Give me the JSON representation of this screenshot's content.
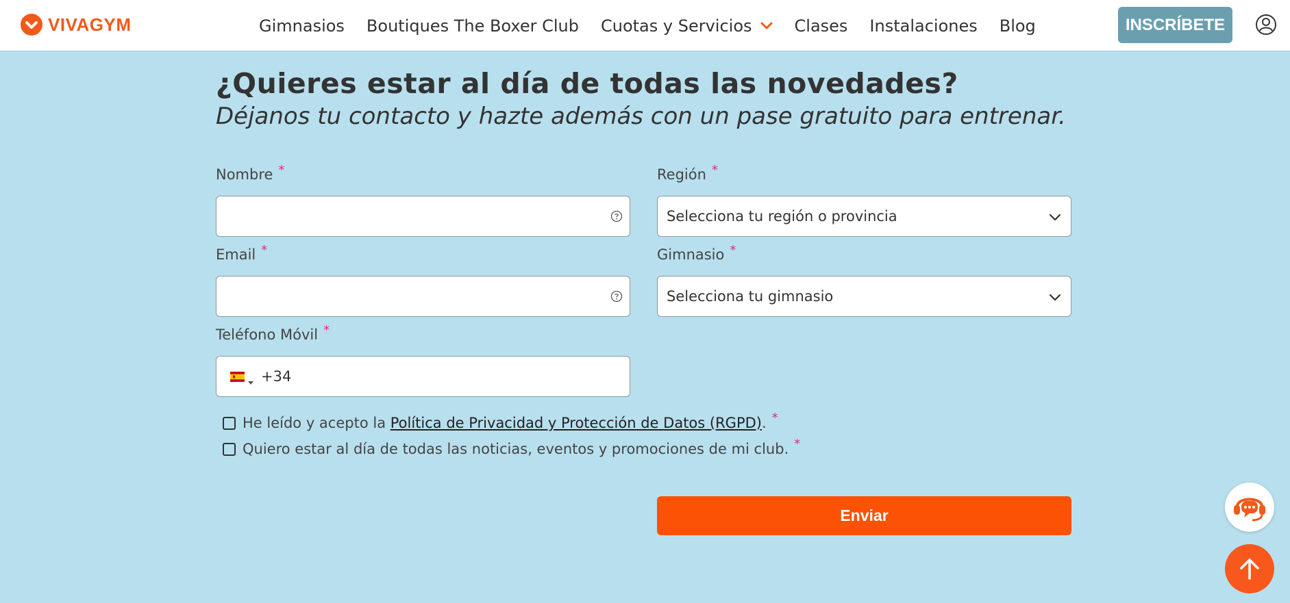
{
  "header": {
    "logo_text": "VIVAGYM",
    "nav": [
      {
        "label": "Gimnasios"
      },
      {
        "label": "Boutiques The Boxer Club"
      },
      {
        "label": "Cuotas y Servicios"
      },
      {
        "label": "Clases"
      },
      {
        "label": "Instalaciones"
      },
      {
        "label": "Blog"
      }
    ],
    "signup_label": "INSCRÍBETE",
    "accent_color": "#f05a1a",
    "signup_color": "#6a9fb0"
  },
  "main": {
    "headline": "¿Quieres estar al día de todas las novedades?",
    "subline": "Déjanos tu contacto y hazte además con un pase gratuito para entrenar.",
    "background_color": "#b8dfee"
  },
  "form": {
    "name_label": "Nombre",
    "name_value": "",
    "email_label": "Email",
    "email_value": "",
    "phone_label": "Teléfono Móvil",
    "phone_code": "+34",
    "region_label": "Región",
    "region_selected": "Selecciona tu región o provincia",
    "gym_label": "Gimnasio",
    "gym_selected": "Selecciona tu gimnasio",
    "required_mark": "*",
    "privacy_prefix": "He leído y acepto la ",
    "privacy_link": "Política de Privacidad y Protección de Datos (RGPD)",
    "privacy_suffix": ".",
    "privacy_checked": false,
    "newsletter_text": "Quiero estar al día de todas las noticias, eventos y promociones de mi club.",
    "newsletter_checked": false,
    "submit_label": "Enviar",
    "submit_color": "#fc5206",
    "required_color": "#e8267a"
  },
  "icons": {
    "logo": "heart-check-icon",
    "nav_dropdown": "chevron-down-icon",
    "user": "user-circle-icon",
    "field_help": "question-circle-icon",
    "select": "chevron-down-icon",
    "phone_flag": "spain-flag-icon",
    "chat": "headset-chat-icon",
    "back_to_top": "arrow-up-icon"
  }
}
